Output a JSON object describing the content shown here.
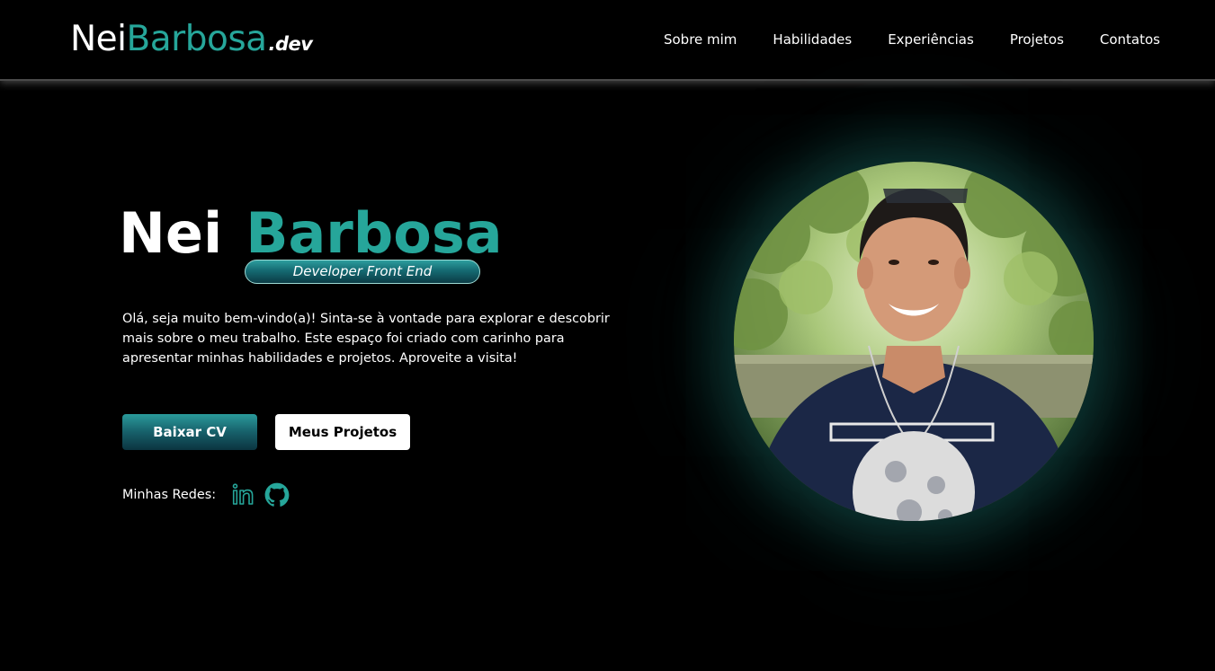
{
  "header": {
    "logo": {
      "first": "Nei",
      "last": "Barbosa",
      "ext": ".dev"
    },
    "nav": [
      "Sobre mim",
      "Habilidades",
      "Experiências",
      "Projetos",
      "Contatos"
    ]
  },
  "hero": {
    "first_name": "Nei",
    "last_name": "Barbosa",
    "role": "Developer Front End",
    "intro": "Olá, seja muito bem-vindo(a)! Sinta-se à vontade para explorar e descobrir mais sobre o meu trabalho. Este espaço foi criado com carinho para apresentar minhas habilidades e projetos. Aproveite a visita!",
    "buttons": {
      "cv": "Baixar CV",
      "projects": "Meus Projetos"
    },
    "socials": {
      "label": "Minhas Redes:",
      "icons": [
        "linkedin-icon",
        "github-icon"
      ]
    }
  },
  "colors": {
    "accent": "#26a69a",
    "background": "#000000",
    "text": "#ffffff"
  }
}
